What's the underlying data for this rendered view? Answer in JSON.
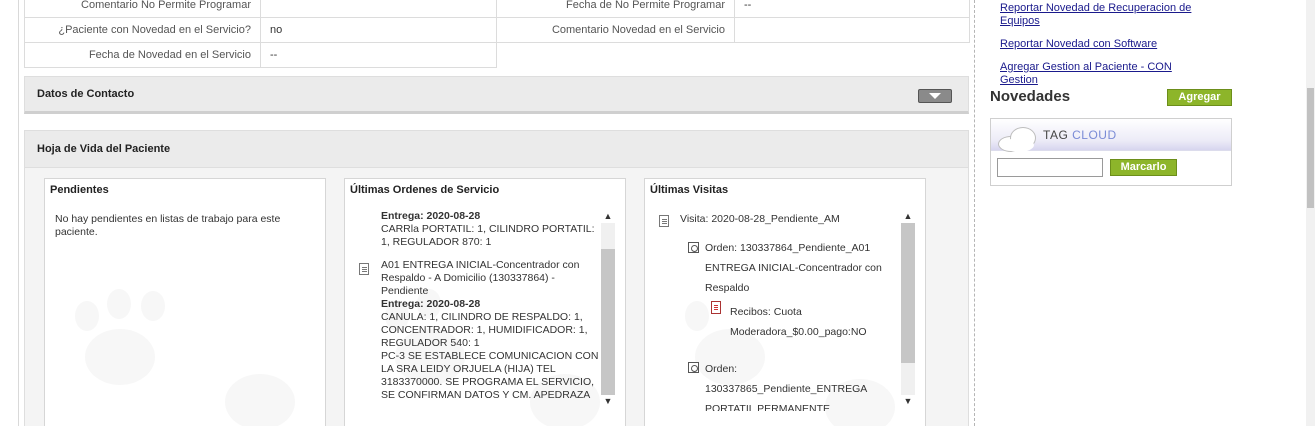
{
  "info_table": {
    "row1": {
      "label_left": "Comentario No Permite Programar",
      "value_left": "",
      "label_right": "Fecha de No Permite Programar",
      "value_right": "--"
    },
    "row2": {
      "label_left": "¿Paciente con Novedad en el Servicio?",
      "value_left": "no",
      "label_right": "Comentario Novedad en el Servicio",
      "value_right": ""
    },
    "row3": {
      "label_left": "Fecha de Novedad en el Servicio",
      "value_left": "--"
    }
  },
  "sections": {
    "contact_title": "Datos de Contacto",
    "hoja_vida_title": "Hoja de Vida del Paciente"
  },
  "pendientes": {
    "title": "Pendientes",
    "message": "No hay pendientes en listas de trabajo para este paciente."
  },
  "ordenes": {
    "title": "Últimas Ordenes de Servicio",
    "entry1": {
      "delivery": "Entrega: 2020-08-28",
      "items_l1": "CARRla PORTATIL: 1, CILINDRO PORTATIL:",
      "items_l2": "1, REGULADOR 870: 1"
    },
    "entry2": {
      "desc_l1": "A01 ENTREGA INICIAL-Concentrador con",
      "desc_l2": "Respaldo - A Domicilio (130337864) -",
      "desc_l3": "Pendiente",
      "delivery": "Entrega: 2020-08-28",
      "items_l1": "CANULA: 1, CILINDRO DE RESPALDO: 1,",
      "items_l2": "CONCENTRADOR: 1, HUMIDIFICADOR: 1,",
      "items_l3": "REGULADOR 540: 1",
      "note_l1": "PC-3 SE ESTABLECE COMUNICACION CON",
      "note_l2": "LA SRA LEIDY ORJUELA (HIJA) TEL",
      "note_l3": "3183370000. SE PROGRAMA EL SERVICIO,",
      "note_l4": "SE CONFIRMAN DATOS Y CM. APEDRAZA"
    }
  },
  "visitas": {
    "title": "Últimas Visitas",
    "visit_label": "Visita: 2020-08-28_Pendiente_AM",
    "order1_l1": "Orden: 130337864_Pendiente_A01",
    "order1_l2": "ENTREGA INICIAL-Concentrador con",
    "order1_l3": "Respaldo",
    "receipt_l1": "Recibos: Cuota",
    "receipt_l2": "Moderadora_$0.00_pago:NO",
    "order2_l1": "Orden:",
    "order2_l2": "130337865_Pendiente_ENTREGA",
    "order2_l3": "PORTATIL PERMANENTE"
  },
  "sidebar": {
    "link1_l1": "Reportar Novedad de Recuperacion de",
    "link1_l2": "Equipos",
    "link2": "Reportar Novedad con Software",
    "link3": "Agregar Gestion al Paciente - CON Gestion",
    "novedades_title": "Novedades",
    "agregar_label": "Agregar",
    "tagcloud_part1": "TAG",
    "tagcloud_part2": "CLOUD",
    "tag_input_value": "",
    "marcarlo_label": "Marcarlo"
  },
  "icons": {
    "collapse": "chevron-down-icon",
    "document": "document-icon",
    "order": "order-icon",
    "receipt": "receipt-icon",
    "cloud": "cloud-icon",
    "scroll_up": "▲",
    "scroll_down": "▼"
  },
  "colors": {
    "accent_green": "#8db52a",
    "link_blue": "#1a1a8c",
    "panel_gray": "#ebebeb"
  }
}
